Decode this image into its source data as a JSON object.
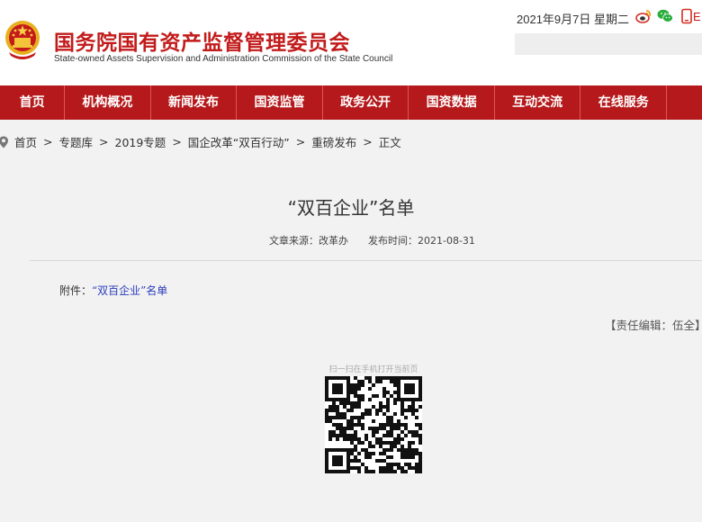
{
  "header": {
    "site_name_cn": "国务院国有资产监督管理委员会",
    "site_name_en": "State-owned Assets Supervision and Administration Commission of the State Council",
    "date": "2021年9月7日 星期二",
    "lang_link": "E",
    "icons": [
      "weibo-icon",
      "wechat-icon",
      "mobile-icon"
    ],
    "brand_color": "#b5191b"
  },
  "nav": {
    "items": [
      {
        "label": "首页"
      },
      {
        "label": "机构概况"
      },
      {
        "label": "新闻发布"
      },
      {
        "label": "国资监管"
      },
      {
        "label": "政务公开"
      },
      {
        "label": "国资数据"
      },
      {
        "label": "互动交流"
      },
      {
        "label": "在线服务"
      }
    ]
  },
  "breadcrumb": [
    "首页",
    "专题库",
    "2019专题",
    "国企改革“双百行动”",
    "重磅发布",
    "正文"
  ],
  "article": {
    "title": "“双百企业”名单",
    "source": "文章来源：改革办",
    "publish_time": "发布时间：2021-08-31",
    "attachment_prefix": "附件：",
    "attachment_link": "“双百企业”名单",
    "editor": "【责任编辑：伍全】",
    "link_color": "#2a3cbd"
  },
  "qr": {
    "caption": "扫一扫在手机打开当前页"
  }
}
